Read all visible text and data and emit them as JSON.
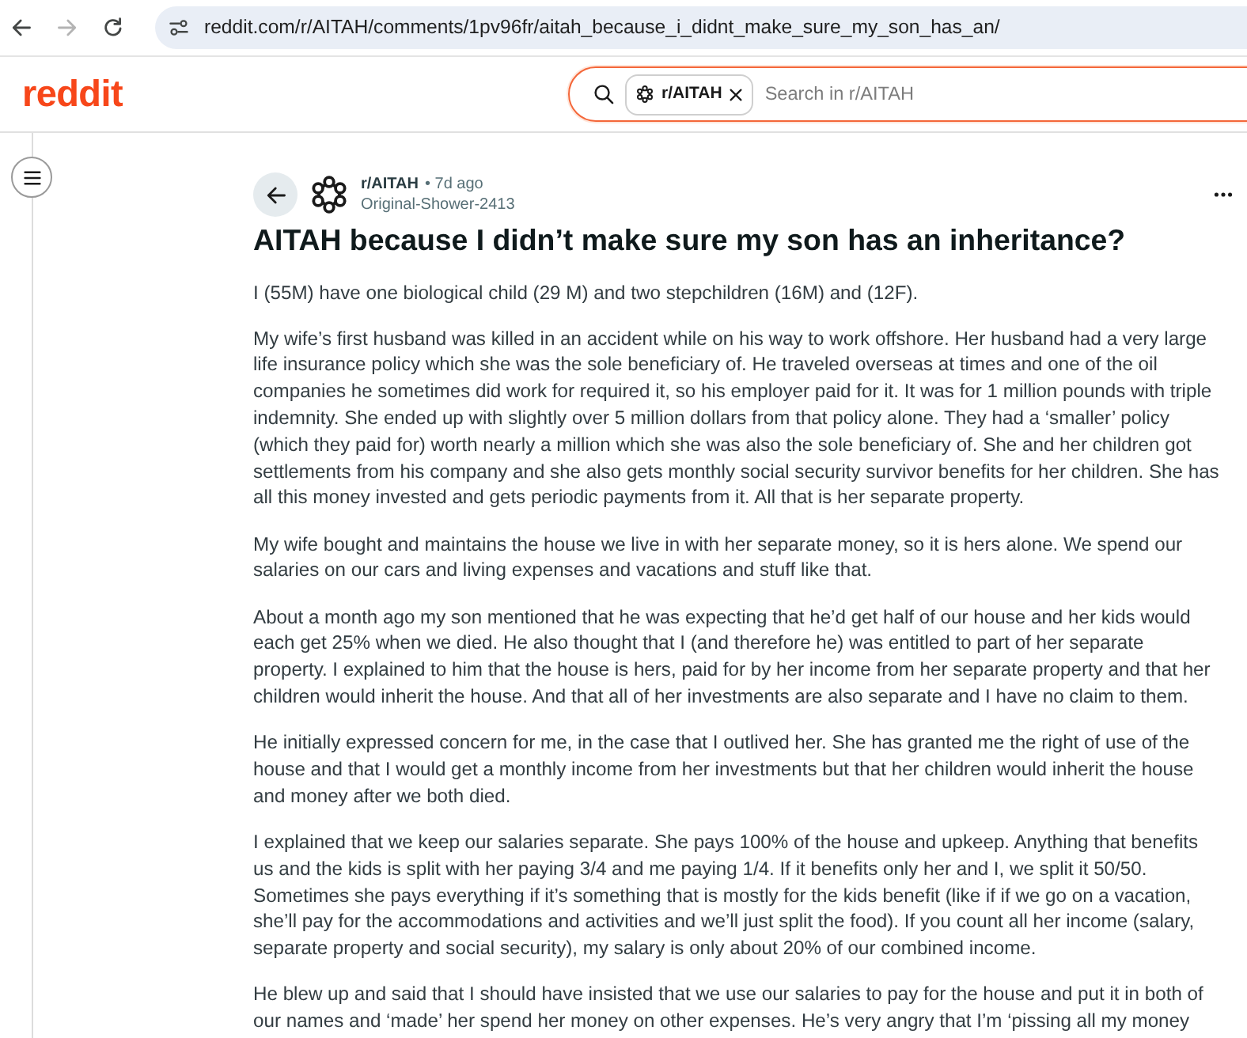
{
  "browser": {
    "nav_buttons": [
      {
        "kind": "back",
        "disabled": false
      },
      {
        "kind": "forward",
        "disabled": true
      },
      {
        "kind": "reload",
        "disabled": false
      }
    ],
    "url": "reddit.com/r/AITAH/comments/1pv96fr/aitah_because_i_didnt_make_sure_my_son_has_an/"
  },
  "header": {
    "logo": "reddit",
    "search": {
      "focused": true,
      "scope_chip": "r/AITAH",
      "placeholder": "Search in r/AITAH"
    }
  },
  "post": {
    "subreddit": "r/AITAH",
    "time": "• 7d ago",
    "author": "Original-Shower-2413",
    "title": "AITAH because I didn’t make sure my son has an inheritance?",
    "paragraphs": [
      "I (55M) have one biological child (29 M) and two stepchildren (16M) and (12F).",
      "My wife’s first husband was killed in an accident while on his way to work offshore. Her husband had a very large life insurance policy which she was the sole beneficiary of. He traveled overseas at times and one of the oil companies he sometimes did work for required it, so his employer paid for it. It was for 1 million pounds with triple indemnity. She ended up with slightly over 5 million dollars from that policy alone. They had a ‘smaller’ policy (which they paid for) worth nearly a million which she was also the sole beneficiary of. She and her children got settlements from his company and she also gets monthly social security survivor benefits for her children. She has all this money invested and gets periodic payments from it. All that is her separate property.",
      "My wife bought and maintains the house we live in with her separate money, so it is hers alone. We spend our salaries on our cars and living expenses and vacations and stuff like that.",
      "About a month ago my son mentioned that he was expecting that he’d get half of our house and her kids would each get 25% when we died. He also thought that I (and therefore he) was entitled to part of her separate property. I explained to him that the house is hers, paid for by her income from her separate property and that her children would inherit the house. And that all of her investments are also separate and I have no claim to them.",
      "He initially expressed concern for me, in the case that I outlived her. She has granted me the right of use of the house and that I would get a monthly income from her investments but that her children would inherit the house and money after we both died.",
      "I explained that we keep our salaries separate. She pays 100% of the house and upkeep. Anything that benefits us and the kids is split with her paying 3/4 and me paying 1/4. If it benefits only her and I, we split it 50/50. Sometimes she pays everything if it’s something that is mostly for the kids benefit (like if if we go on a vacation, she’ll pay for the accommodations and activities and we’ll just split the food). If you count all her income (salary, separate property and social security), my salary is only about 20% of our combined income.",
      "He blew up and said that I should have insisted that we use our salaries to pay for the house and put it in both of our names and ‘made’ her spend her money on other expenses. He’s very angry that I’m ‘pissing all my money"
    ]
  }
}
